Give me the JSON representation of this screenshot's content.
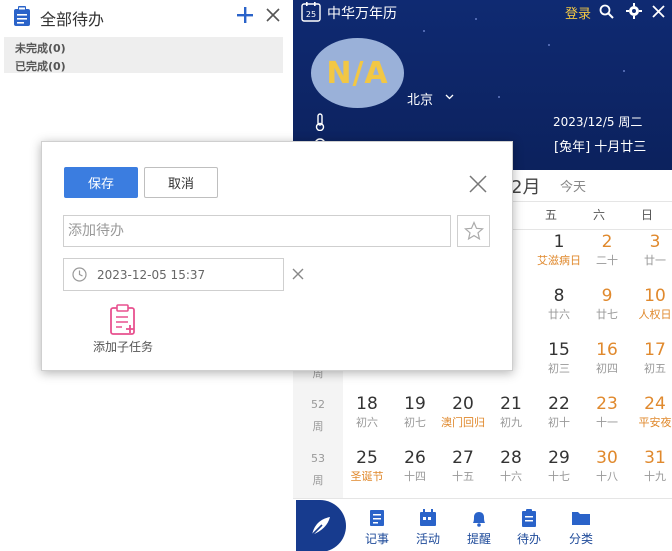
{
  "todo_panel": {
    "title": "全部待办",
    "groups": [
      "未完成(0)",
      "已完成(0)"
    ]
  },
  "calendar": {
    "app_title": "中华万年历",
    "logo_day": "25",
    "login_label": "登录",
    "weather_text": "N/A",
    "city": "北京",
    "solar_date": "2023/12/5  周二",
    "lunar_date": "[兔年]  十月廿三",
    "month_label": "2月",
    "today_label": "今天",
    "weekday_headers": [
      "五",
      "六",
      "日"
    ],
    "week_rows": [
      {
        "week": "",
        "days": [
          {
            "d": "1",
            "l": "艾滋病日",
            "fest": true,
            "wk": false
          },
          {
            "d": "2",
            "l": "二十",
            "fest": false,
            "wk": true
          },
          {
            "d": "3",
            "l": "廿一",
            "fest": false,
            "wk": true
          }
        ]
      },
      {
        "week": "",
        "days": [
          {
            "d": "8",
            "l": "廿六",
            "fest": false,
            "wk": false
          },
          {
            "d": "9",
            "l": "廿七",
            "fest": false,
            "wk": true
          },
          {
            "d": "10",
            "l": "人权日",
            "fest": true,
            "wk": true
          }
        ]
      },
      {
        "week": "",
        "days": [
          {
            "d": "15",
            "l": "初三",
            "fest": false,
            "wk": false
          },
          {
            "d": "16",
            "l": "初四",
            "fest": false,
            "wk": true
          },
          {
            "d": "17",
            "l": "初五",
            "fest": false,
            "wk": true
          }
        ]
      },
      {
        "week": "52",
        "days": [
          {
            "d": "18",
            "l": "初六",
            "fest": false,
            "wk": false
          },
          {
            "d": "19",
            "l": "初七",
            "fest": false,
            "wk": false
          },
          {
            "d": "20",
            "l": "澳门回归",
            "fest": true,
            "wk": false
          },
          {
            "d": "21",
            "l": "初九",
            "fest": false,
            "wk": false
          },
          {
            "d": "22",
            "l": "初十",
            "fest": false,
            "wk": false
          },
          {
            "d": "23",
            "l": "十一",
            "fest": false,
            "wk": true
          },
          {
            "d": "24",
            "l": "平安夜",
            "fest": true,
            "wk": true
          }
        ]
      },
      {
        "week": "53",
        "days": [
          {
            "d": "25",
            "l": "圣诞节",
            "fest": true,
            "wk": false
          },
          {
            "d": "26",
            "l": "十四",
            "fest": false,
            "wk": false
          },
          {
            "d": "27",
            "l": "十五",
            "fest": false,
            "wk": false
          },
          {
            "d": "28",
            "l": "十六",
            "fest": false,
            "wk": false
          },
          {
            "d": "29",
            "l": "十七",
            "fest": false,
            "wk": false
          },
          {
            "d": "30",
            "l": "十八",
            "fest": false,
            "wk": true
          },
          {
            "d": "31",
            "l": "十九",
            "fest": false,
            "wk": true
          }
        ]
      }
    ],
    "week_label": "周",
    "nav": [
      "记事",
      "活动",
      "提醒",
      "待办",
      "分类"
    ]
  },
  "dialog": {
    "save_label": "保存",
    "cancel_label": "取消",
    "todo_placeholder": "添加待办",
    "datetime": "2023-12-05 15:37",
    "subtask_label": "添加子任务"
  },
  "colors": {
    "accent": "#3b7de0",
    "calendar_bg": "#0f2a72",
    "weekend": "#e0892d",
    "gold": "#f2c744"
  }
}
